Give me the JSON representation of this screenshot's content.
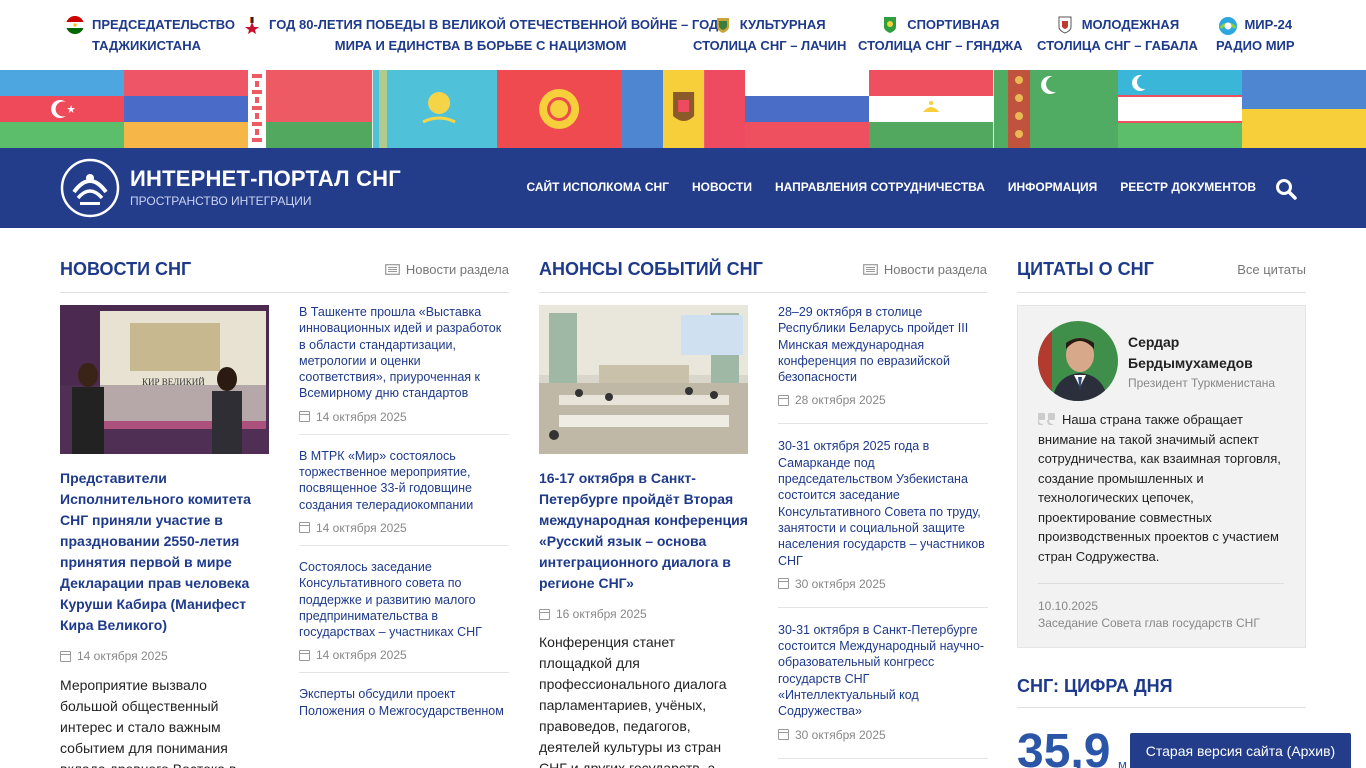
{
  "topbar": {
    "links": [
      {
        "line1": "Председательство",
        "line2": "Таджикистана",
        "icon": "tajikistan-flag-icon"
      },
      {
        "line1": "Год 80-летия Победы в Великой Отечественной войне – Год",
        "line2": "мира и единства в борьбе с нацизмом",
        "icon": "victory-order-icon"
      },
      {
        "line1": "Культурная",
        "line2": "столица СНГ – Лачин",
        "icon": "lachin-emblem-icon"
      },
      {
        "line1": "Спортивная",
        "line2": "столица СНГ – Гянджа",
        "icon": "ganja-emblem-icon"
      },
      {
        "line1": "Молодежная",
        "line2": "столица СНГ – Габала",
        "icon": "gabala-emblem-icon"
      },
      {
        "line1": "Мир-24",
        "line2": "Радио Мир",
        "icon": "mir-logo-icon"
      }
    ]
  },
  "flags": [
    "azerbaijan",
    "armenia",
    "belarus",
    "kazakhstan",
    "kyrgyzstan",
    "moldova",
    "russia",
    "tajikistan",
    "turkmenistan",
    "uzbekistan",
    "ukraine"
  ],
  "header": {
    "title": "ИНТЕРНЕТ-ПОРТАЛ СНГ",
    "subtitle": "ПРОСТРАНСТВО ИНТЕГРАЦИИ",
    "nav": [
      "САЙТ ИСПОЛКОМА СНГ",
      "НОВОСТИ",
      "НАПРАВЛЕНИЯ СОТРУДНИЧЕСТВА",
      "ИНФОРМАЦИЯ",
      "РЕЕСТР ДОКУМЕНТОВ"
    ],
    "accent": "#233d8b"
  },
  "news": {
    "heading": "НОВОСТИ СНГ",
    "more": "Новости раздела",
    "feature": {
      "title": "Представители Исполнительного комитета СНГ приняли участие в праздновании 2550-летия принятия первой в мире Декларации прав человека Куруши Кабира (Манифест Кира Великого)",
      "date": "14 октября 2025",
      "text": "Мероприятие вызвало большой общественный интерес и стало важным событием для понимания вклада древнего Востока в",
      "image_caption": "КИР ВЕЛИКИЙ"
    },
    "items": [
      {
        "title": "В Ташкенте прошла «Выставка инновационных идей и разработок в области стандартизации, метрологии и оценки соответствия», приуроченная к Всемирному дню стандартов",
        "date": "14 октября 2025"
      },
      {
        "title": "В МТРК «Мир» состоялось торжественное мероприятие, посвященное 33-й годовщине создания телерадиокомпании",
        "date": "14 октября 2025"
      },
      {
        "title": "Состоялось заседание Консультативного совета по поддержке и развитию малого предпринимательства в государствах – участниках СНГ",
        "date": "14 октября 2025"
      },
      {
        "title": "Эксперты обсудили проект Положения о Межгосударственном",
        "date": ""
      }
    ]
  },
  "events": {
    "heading": "АНОНСЫ СОБЫТИЙ СНГ",
    "more": "Новости раздела",
    "feature": {
      "title": "16-17 октября в Санкт-Петербурге пройдёт Вторая международная конференция «Русский язык – основа интеграционного диалога в регионе СНГ»",
      "date": "16 октября 2025",
      "text": "Конференция станет площадкой для профессионального диалога парламентариев, учёных, правоведов, педагогов, деятелей культуры из стран СНГ и других государств, а"
    },
    "items": [
      {
        "title": "28–29 октября в столице Республики Беларусь пройдет III Минская международная конференция по евразийской безопасности",
        "date": "28 октября 2025"
      },
      {
        "title": "30-31 октября 2025 года в Самарканде под председательством Узбекистана состоится заседание Консультативного Совета по труду, занятости и социальной защите населения государств – участников СНГ",
        "date": "30 октября 2025"
      },
      {
        "title": "30-31 октября в Санкт-Петербурге состоится Международный научно-образовательный конгресс государств СНГ «Интеллектуальный код Содружества»",
        "date": "30 октября 2025"
      }
    ]
  },
  "quotes": {
    "heading": "ЦИТАТЫ О СНГ",
    "more": "Все цитаты",
    "name": "Сердар Бердымухамедов",
    "role": "Президент Туркменистана",
    "text": "Наша страна также обращает внимание на такой значимый аспект сотрудничества, как взаимная торговля, создание промышленных и технологических цепочек, проектирование совместных производственных проектов с участием стран Содружества.",
    "date": "10.10.2025",
    "event": "Заседание Совета глав государств СНГ"
  },
  "digit": {
    "heading": "СНГ: ЦИФРА ДНЯ",
    "value": "35,9",
    "unit": "м"
  },
  "old_site": "Старая версия сайта (Архив)"
}
